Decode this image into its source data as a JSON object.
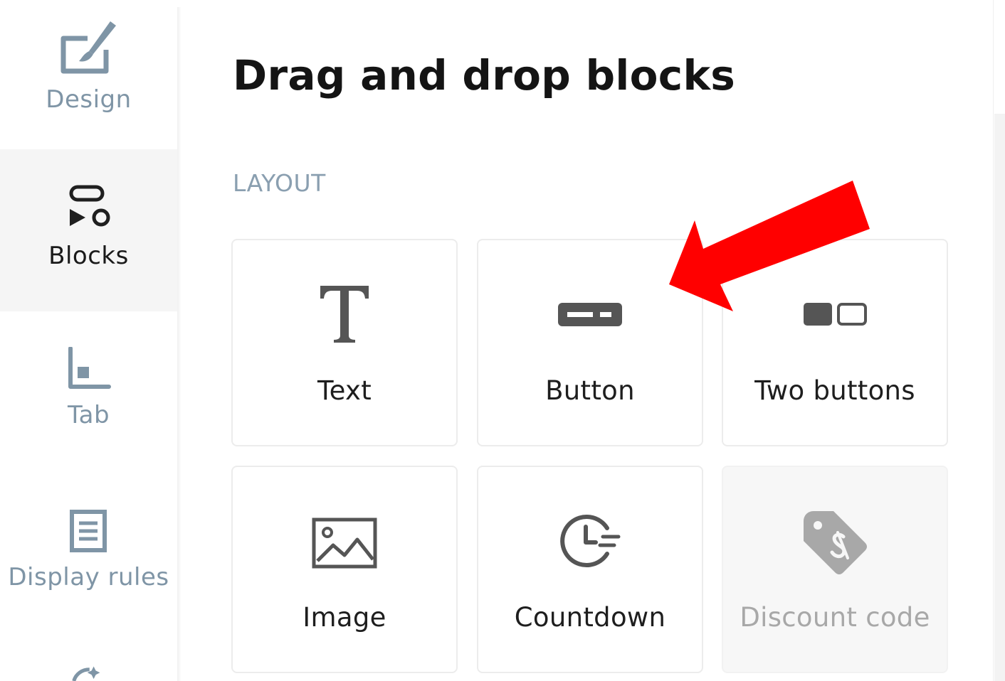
{
  "sidebar": {
    "items": [
      {
        "label": "Design",
        "icon": "brush-canvas-icon",
        "active": false
      },
      {
        "label": "Blocks",
        "icon": "shapes-icon",
        "active": true
      },
      {
        "label": "Tab",
        "icon": "tab-corner-icon",
        "active": false
      },
      {
        "label": "Display rules",
        "icon": "document-list-icon",
        "active": false
      }
    ]
  },
  "main": {
    "title": "Drag and drop blocks",
    "section": "LAYOUT",
    "blocks": [
      {
        "label": "Text",
        "icon": "text-t-icon",
        "disabled": false
      },
      {
        "label": "Button",
        "icon": "button-icon",
        "disabled": false
      },
      {
        "label": "Two buttons",
        "icon": "two-buttons-icon",
        "disabled": false
      },
      {
        "label": "Image",
        "icon": "image-icon",
        "disabled": false
      },
      {
        "label": "Countdown",
        "icon": "countdown-clock-icon",
        "disabled": false
      },
      {
        "label": "Discount code",
        "icon": "price-tag-icon",
        "disabled": true
      }
    ]
  },
  "colors": {
    "nav_inactive": "#7f95a6",
    "nav_active_bg": "#f5f5f5",
    "section_label": "#8a9fb0",
    "icon_gray": "#555555",
    "annotation_arrow": "#ff0000"
  }
}
